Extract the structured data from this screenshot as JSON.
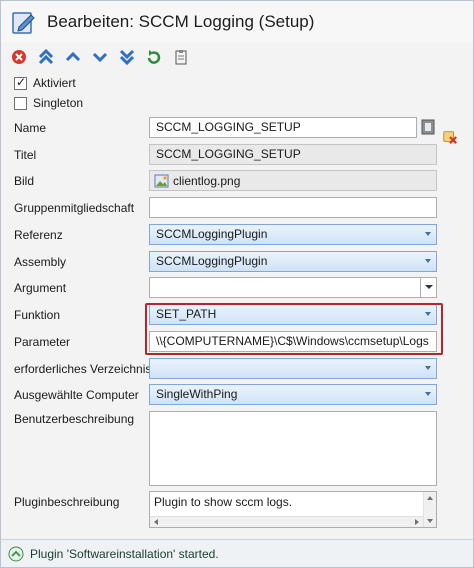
{
  "window": {
    "title": "Bearbeiten: SCCM Logging (Setup)"
  },
  "toolbar": {
    "buttons": [
      "delete-icon",
      "move-top-icon",
      "move-up-icon",
      "move-down-icon",
      "move-bottom-icon",
      "refresh-icon",
      "clipboard-icon"
    ]
  },
  "form": {
    "aktiviert_label": "Aktiviert",
    "aktiviert_checked": true,
    "singleton_label": "Singleton",
    "singleton_checked": false,
    "name_label": "Name",
    "name_value": "SCCM_LOGGING_SETUP",
    "titel_label": "Titel",
    "titel_value": "SCCM_LOGGING_SETUP",
    "bild_label": "Bild",
    "bild_value": "clientlog.png",
    "gruppe_label": "Gruppenmitgliedschaft",
    "gruppe_value": "",
    "referenz_label": "Referenz",
    "referenz_value": "SCCMLoggingPlugin",
    "assembly_label": "Assembly",
    "assembly_value": "SCCMLoggingPlugin",
    "argument_label": "Argument",
    "argument_value": "",
    "funktion_label": "Funktion",
    "funktion_value": "SET_PATH",
    "parameter_label": "Parameter",
    "parameter_value": "\\\\{COMPUTERNAME}\\C$\\Windows\\ccmsetup\\Logs",
    "verzeichnis_label": "erforderliches Verzeichnis",
    "verzeichnis_value": "",
    "computer_label": "Ausgewählte Computer",
    "computer_value": "SingleWithPing",
    "benutzer_label": "Benutzerbeschreibung",
    "benutzer_value": "",
    "plugin_label": "Pluginbeschreibung",
    "plugin_value": "Plugin to show sccm logs."
  },
  "status": {
    "text": "Plugin 'Softwareinstallation' started."
  },
  "colors": {
    "highlight_border": "#b3262f",
    "combo_gradient_bottom": "#cfe2f7",
    "status_text": "#1a3d2a"
  }
}
